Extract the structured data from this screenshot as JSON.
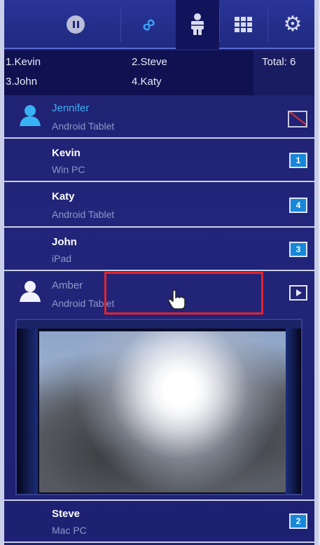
{
  "toolbar": {
    "buttons": [
      {
        "name": "pause-icon",
        "active": false
      },
      {
        "name": "link-icon",
        "active": false
      },
      {
        "name": "users-icon",
        "active": true
      },
      {
        "name": "grid-icon",
        "active": false
      },
      {
        "name": "gear-icon",
        "active": false
      }
    ]
  },
  "summary": {
    "slot1": "1.Kevin",
    "slot2": "2.Steve",
    "slot3": "3.John",
    "slot4": "4.Katy",
    "total": "Total: 6"
  },
  "users": [
    {
      "name": "Jennifer",
      "device": "Android Tablet",
      "state": "host",
      "slot": ""
    },
    {
      "name": "Kevin",
      "device": "Win PC",
      "state": "presenting",
      "slot": "1"
    },
    {
      "name": "Katy",
      "device": "Android Tablet",
      "state": "presenting",
      "slot": "4"
    },
    {
      "name": "John",
      "device": "iPad",
      "state": "presenting",
      "slot": "3"
    },
    {
      "name": "Amber",
      "device": "Android Tablet",
      "state": "preview",
      "slot": ""
    },
    {
      "name": "Steve",
      "device": "Mac PC",
      "state": "presenting",
      "slot": "2"
    }
  ],
  "colors": {
    "accent": "#1787d8",
    "host_name": "#38b2f2",
    "highlight": "#e3242b",
    "background": "#1e2072"
  }
}
